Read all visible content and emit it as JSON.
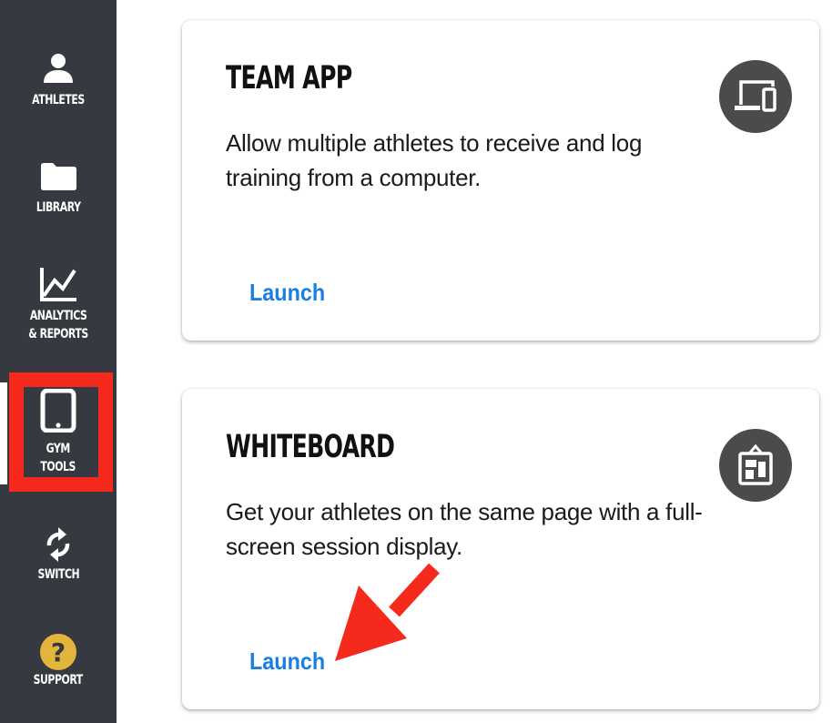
{
  "sidebar": {
    "items": [
      {
        "id": "athletes",
        "label_lines": [
          "ATHLETES"
        ],
        "icon": "person-icon"
      },
      {
        "id": "library",
        "label_lines": [
          "LIBRARY"
        ],
        "icon": "folder-icon"
      },
      {
        "id": "analytics",
        "label_lines": [
          "ANALYTICS",
          "& REPORTS"
        ],
        "icon": "line-chart-icon"
      },
      {
        "id": "gym-tools",
        "label_lines": [
          "GYM",
          "TOOLS"
        ],
        "icon": "tablet-icon",
        "highlighted": true
      },
      {
        "id": "switch",
        "label_lines": [
          "SWITCH"
        ],
        "icon": "refresh-icon"
      },
      {
        "id": "support",
        "label_lines": [
          "SUPPORT"
        ],
        "icon": "help-circle-icon"
      }
    ],
    "colors": {
      "background": "#363940",
      "text": "#ffffff",
      "support_icon": "#e4b53c",
      "highlight": "#f52a1c"
    }
  },
  "cards": [
    {
      "title": "TEAM APP",
      "description": "Allow multiple athletes to receive and log training from a computer.",
      "action_label": "Launch",
      "icon": "devices-icon"
    },
    {
      "title": "WHITEBOARD",
      "description": "Get your athletes on the same page with a full-screen session display.",
      "action_label": "Launch",
      "icon": "whiteboard-icon"
    }
  ],
  "annotation": {
    "type": "arrow",
    "target": "whiteboard-launch-link",
    "color": "#f52a1c"
  },
  "colors": {
    "link": "#1a7fe0",
    "icon_circle": "#4b4b4b"
  }
}
